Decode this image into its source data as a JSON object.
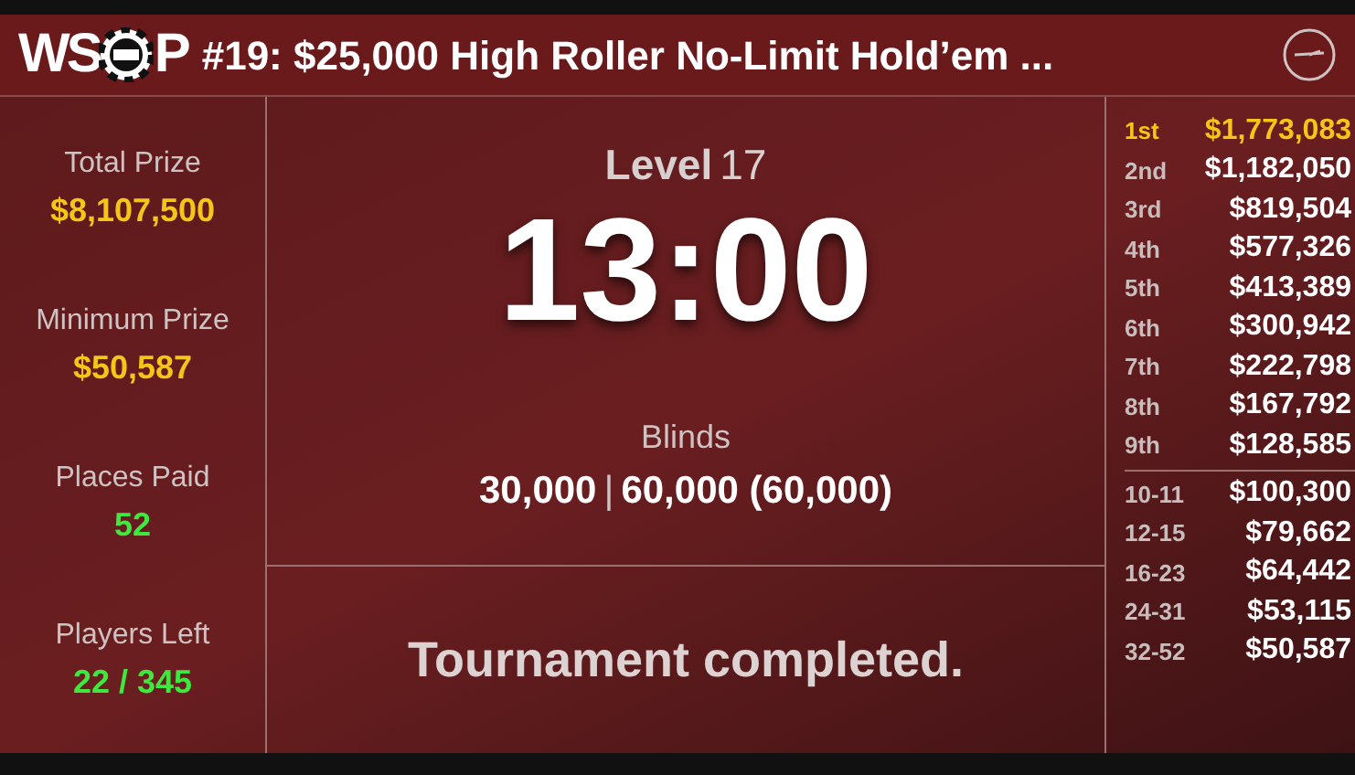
{
  "header": {
    "logo": {
      "left": "WS",
      "right": "P"
    },
    "title": "#19: $25,000 High Roller No-Limit Hold’em ..."
  },
  "stats": [
    {
      "label": "Total Prize",
      "value": "$8,107,500",
      "color": "#f5c518"
    },
    {
      "label": "Minimum Prize",
      "value": "$50,587",
      "color": "#f5c518"
    },
    {
      "label": "Places Paid",
      "value": "52",
      "color": "#3ee83e"
    },
    {
      "label": "Players Left",
      "value": "22 / 345",
      "color": "#3ee83e"
    }
  ],
  "level": {
    "label": "Level",
    "number": "17"
  },
  "clock": "13:00",
  "blinds": {
    "label": "Blinds",
    "small": "30,000",
    "separator": "|",
    "big": "60,000 (60,000)"
  },
  "message": "Tournament completed.",
  "payouts": {
    "places": [
      {
        "place": "1st",
        "amount": "$1,773,083",
        "highlighted": true
      },
      {
        "place": "2nd",
        "amount": "$1,182,050",
        "highlighted": false
      },
      {
        "place": "3rd",
        "amount": "$819,504",
        "highlighted": false
      },
      {
        "place": "4th",
        "amount": "$577,326",
        "highlighted": false
      },
      {
        "place": "5th",
        "amount": "$413,389",
        "highlighted": false
      },
      {
        "place": "6th",
        "amount": "$300,942",
        "highlighted": false
      },
      {
        "place": "7th",
        "amount": "$222,798",
        "highlighted": false
      },
      {
        "place": "8th",
        "amount": "$167,792",
        "highlighted": false
      },
      {
        "place": "9th",
        "amount": "$128,585",
        "highlighted": false
      }
    ],
    "ranges": [
      {
        "place": "10-11",
        "amount": "$100,300",
        "highlighted": false
      },
      {
        "place": "12-15",
        "amount": "$79,662",
        "highlighted": false
      },
      {
        "place": "16-23",
        "amount": "$64,442",
        "highlighted": false
      },
      {
        "place": "24-31",
        "amount": "$53,115",
        "highlighted": false
      },
      {
        "place": "32-52",
        "amount": "$50,587",
        "highlighted": false
      }
    ]
  }
}
